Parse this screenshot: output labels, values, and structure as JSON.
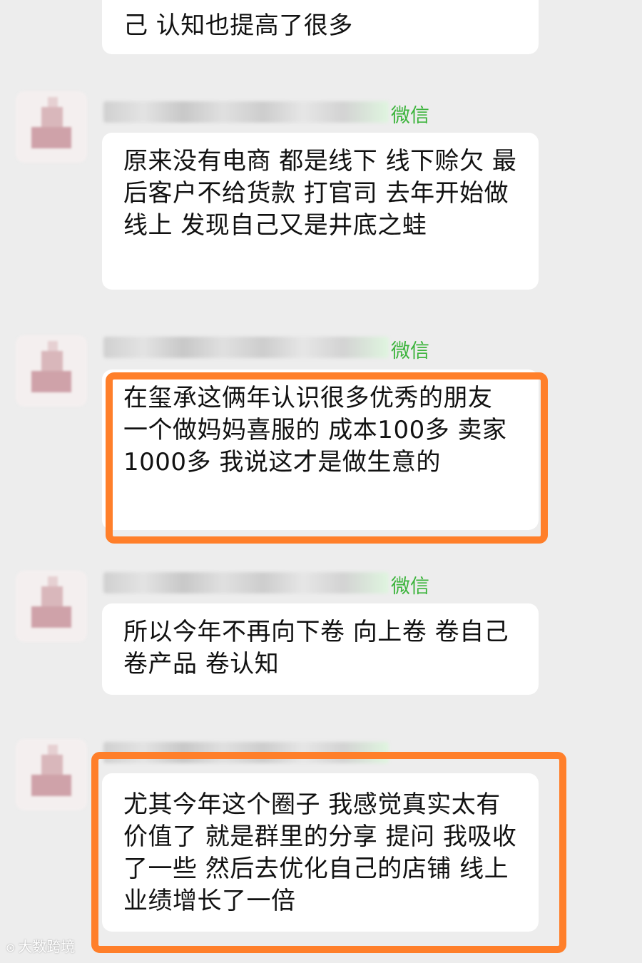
{
  "messages": [
    {
      "text": "己 认知也提高了很多",
      "sender_tag": ""
    },
    {
      "text": "原来没有电商 都是线下 线下赊欠 最后客户不给货款 打官司 去年开始做线上 发现自己又是井底之蛙",
      "sender_tag": "微信"
    },
    {
      "text": "在玺承这俩年认识很多优秀的朋友 一个做妈妈喜服的 成本100多 卖家1000多 我说这才是做生意的",
      "sender_tag": "微信",
      "highlighted": true
    },
    {
      "text": "所以今年不再向下卷 向上卷 卷自己 卷产品 卷认知",
      "sender_tag": "微信"
    },
    {
      "text": "尤其今年这个圈子 我感觉真实太有价值了 就是群里的分享 提问 我吸收了一些 然后去优化自己的店铺 线上业绩增长了一倍",
      "sender_tag": "",
      "highlighted": true
    }
  ],
  "watermark": "大数跨境",
  "colors": {
    "highlight": "#ff7f2a",
    "tag": "#3cb43c",
    "background": "#ededed"
  }
}
